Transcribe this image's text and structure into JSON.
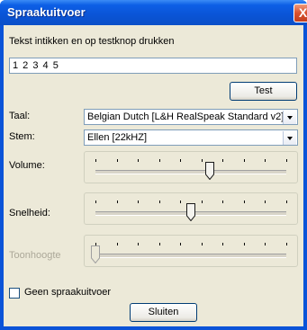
{
  "window": {
    "title": "Spraakuitvoer",
    "close_label": "X"
  },
  "prompt": "Tekst intikken en op testknop drukken",
  "input": {
    "value": "1 2 3 4 5"
  },
  "test_button": "Test",
  "taal": {
    "label": "Taal:",
    "value": "Belgian Dutch [L&H RealSpeak Standard v2]"
  },
  "stem": {
    "label": "Stem:",
    "value": "Ellen [22kHZ]"
  },
  "volume": {
    "label": "Volume:",
    "position": 0.6
  },
  "snelheid": {
    "label": "Snelheid:",
    "position": 0.5
  },
  "toonhoogte": {
    "label": "Toonhoogte",
    "position": 0.0,
    "enabled": false
  },
  "geen_checkbox": {
    "label": "Geen spraakuitvoer",
    "checked": false
  },
  "close_button": "Sluiten"
}
